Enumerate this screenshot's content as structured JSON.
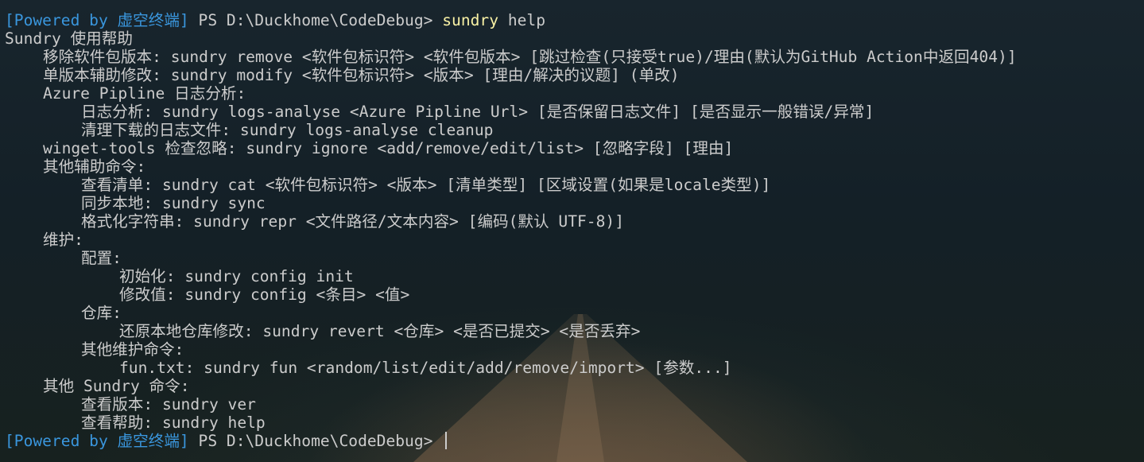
{
  "terminal": {
    "prompt_prefix": "[Powered by 虚空终端]",
    "prompt_path": " PS D:\\Duckhome\\CodeDebug> ",
    "command": "sundry",
    "command_args": " help",
    "output_lines": [
      {
        "indent": 0,
        "text": "Sundry 使用帮助"
      },
      {
        "indent": 1,
        "text": "移除软件包版本: sundry remove <软件包标识符> <软件包版本> [跳过检查(只接受true)/理由(默认为GitHub Action中返回404)]"
      },
      {
        "indent": 1,
        "text": "单版本辅助修改: sundry modify <软件包标识符> <版本> [理由/解决的议题] (单改)"
      },
      {
        "indent": 1,
        "text": "Azure Pipline 日志分析:"
      },
      {
        "indent": 2,
        "text": "日志分析: sundry logs-analyse <Azure Pipline Url> [是否保留日志文件] [是否显示一般错误/异常]"
      },
      {
        "indent": 2,
        "text": "清理下载的日志文件: sundry logs-analyse cleanup"
      },
      {
        "indent": 1,
        "text": "winget-tools 检查忽略: sundry ignore <add/remove/edit/list> [忽略字段] [理由]"
      },
      {
        "indent": 1,
        "text": "其他辅助命令:"
      },
      {
        "indent": 2,
        "text": "查看清单: sundry cat <软件包标识符> <版本> [清单类型] [区域设置(如果是locale类型)]"
      },
      {
        "indent": 2,
        "text": "同步本地: sundry sync"
      },
      {
        "indent": 2,
        "text": "格式化字符串: sundry repr <文件路径/文本内容> [编码(默认 UTF-8)]"
      },
      {
        "indent": 1,
        "text": "维护:"
      },
      {
        "indent": 2,
        "text": "配置:"
      },
      {
        "indent": 3,
        "text": "初始化: sundry config init"
      },
      {
        "indent": 3,
        "text": "修改值: sundry config <条目> <值>"
      },
      {
        "indent": 2,
        "text": "仓库:"
      },
      {
        "indent": 3,
        "text": "还原本地仓库修改: sundry revert <仓库> <是否已提交> <是否丢弃>"
      },
      {
        "indent": 2,
        "text": "其他维护命令:"
      },
      {
        "indent": 3,
        "text": "fun.txt: sundry fun <random/list/edit/add/remove/import> [参数...]"
      },
      {
        "indent": 1,
        "text": "其他 Sundry 命令:"
      },
      {
        "indent": 2,
        "text": "查看版本: sundry ver"
      },
      {
        "indent": 2,
        "text": "查看帮助: sundry help"
      }
    ],
    "final_prompt_prefix": "[Powered by 虚空终端]",
    "final_prompt_path": " PS D:\\Duckhome\\CodeDebug> "
  },
  "colors": {
    "background": "#152028",
    "text": "#cccccc",
    "powered": "#3a96dd",
    "command": "#f9f1a5"
  }
}
